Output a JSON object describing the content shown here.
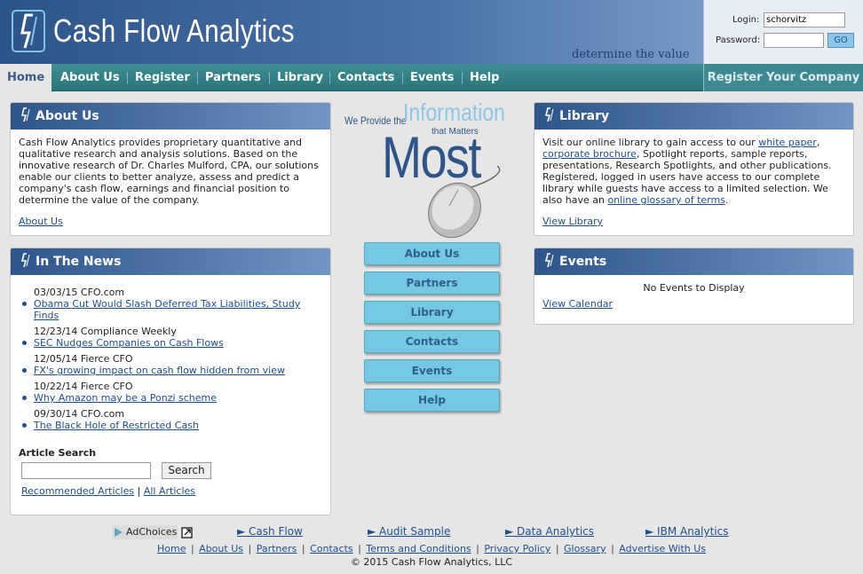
{
  "header": {
    "brand": "Cash Flow Analytics",
    "tagline": "determine the value",
    "login": {
      "login_label": "Login:",
      "login_value": "schorvitz",
      "password_label": "Password:",
      "go_label": "GO"
    }
  },
  "nav": {
    "items": [
      {
        "label": "Home"
      },
      {
        "label": "About Us"
      },
      {
        "label": "Register"
      },
      {
        "label": "Partners"
      },
      {
        "label": "Library"
      },
      {
        "label": "Contacts"
      },
      {
        "label": "Events"
      },
      {
        "label": "Help"
      }
    ],
    "register_company": "Register Your Company"
  },
  "about": {
    "title": "About Us",
    "body": "Cash Flow Analytics provides proprietary quantitative and qualitative research and analysis solutions. Based on the innovative research of Dr. Charles Mulford, CPA, our solutions enable our clients to better analyze, assess and predict a company's cash flow, earnings and financial position to determine the value of the company.",
    "link": "About Us"
  },
  "news": {
    "title": "In The News",
    "items": [
      {
        "meta": "03/03/15 CFO.com",
        "headline": "Obama Cut Would Slash Deferred Tax Liabilities, Study Finds"
      },
      {
        "meta": "12/23/14 Compliance Weekly",
        "headline": "SEC Nudges Companies on Cash Flows"
      },
      {
        "meta": "12/05/14 Fierce CFO",
        "headline": "FX's growing impact on cash flow hidden from view"
      },
      {
        "meta": "10/22/14 Fierce CFO",
        "headline": "Why Amazon may be a Ponzi scheme"
      },
      {
        "meta": "09/30/14 CFO.com",
        "headline": "The Black Hole of Restricted Cash"
      }
    ],
    "search_label": "Article Search",
    "search_button": "Search",
    "recommended": "Recommended Articles",
    "all": "All Articles",
    "sep": "|"
  },
  "promo": {
    "line1": "We Provide the",
    "line2": "Information",
    "line3": "that Matters",
    "line4": "Most"
  },
  "center_buttons": [
    "About Us",
    "Partners",
    "Library",
    "Contacts",
    "Events",
    "Help"
  ],
  "library": {
    "title": "Library",
    "text_1": "Visit our online library to gain access to our ",
    "link_white_paper": "white paper",
    "comma": ",",
    "link_brochure": "corporate brochure",
    "text_2": ", Spotlight reports, sample reports, presentations, Research Spotlights, and other publications. Registered, logged in users have access to our complete library while guests have access to a limited selection. We also have an ",
    "link_glossary": "online glossary of terms",
    "period": ".",
    "link": "View Library"
  },
  "events": {
    "title": "Events",
    "empty": "No Events to Display",
    "link": "View Calendar"
  },
  "footer": {
    "adchoices": "AdChoices",
    "ad_links": [
      "► Cash Flow",
      "► Audit Sample",
      "► Data Analytics",
      "► IBM Analytics"
    ],
    "links": [
      "Home",
      "About Us",
      "Partners",
      "Contacts",
      "Terms and Conditions",
      "Privacy Policy",
      "Glossary",
      "Advertise With Us"
    ],
    "copyright": "© 2015 Cash Flow Analytics, LLC"
  },
  "colors": {
    "header_blue": "#2e5589",
    "nav_teal": "#2b7479",
    "button_cyan": "#75c8e2",
    "link_blue": "#1f4e8c"
  }
}
